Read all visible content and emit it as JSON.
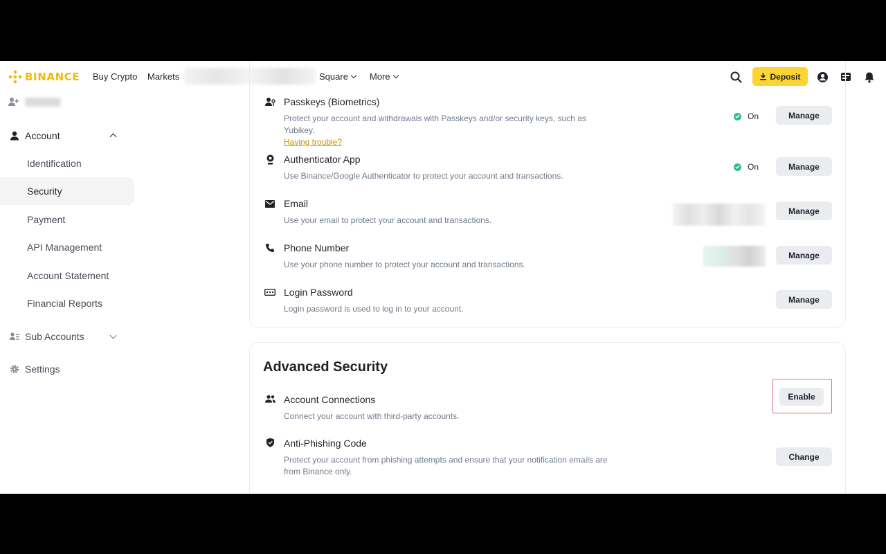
{
  "nav": {
    "logo": "BINANCE",
    "items": [
      "Buy Crypto",
      "Markets",
      "Square",
      "More"
    ],
    "deposit": "Deposit"
  },
  "sidebar": {
    "account": "Account",
    "items": [
      "Identification",
      "Security",
      "Payment",
      "API Management",
      "Account Statement",
      "Financial Reports"
    ],
    "active": "Security",
    "sub_accounts": "Sub Accounts",
    "settings": "Settings"
  },
  "security_rows": [
    {
      "title": "Passkeys (Biometrics)",
      "desc": "Protect your account and withdrawals with Passkeys and/or security keys, such as Yubikey.",
      "link": "Having trouble?",
      "status": "On",
      "button": "Manage",
      "icon": "passkey-icon"
    },
    {
      "title": "Authenticator App",
      "desc": "Use Binance/Google Authenticator to protect your account and transactions.",
      "status": "On",
      "button": "Manage",
      "icon": "authenticator-icon"
    },
    {
      "title": "Email",
      "desc": "Use your email to protect your account and transactions.",
      "button": "Manage",
      "icon": "mail-icon"
    },
    {
      "title": "Phone Number",
      "desc": "Use your phone number to protect your account and transactions.",
      "button": "Manage",
      "icon": "phone-icon"
    },
    {
      "title": "Login Password",
      "desc": "Login password is used to log in to your account.",
      "button": "Manage",
      "icon": "password-icon"
    }
  ],
  "advanced": {
    "title": "Advanced Security",
    "rows": [
      {
        "title": "Account Connections",
        "desc": "Connect your account with third-party accounts.",
        "button": "Enable",
        "icon": "people-icon"
      },
      {
        "title": "Anti-Phishing Code",
        "desc": "Protect your account from phishing attempts and ensure that your notification emails are from Binance only.",
        "button": "Change",
        "icon": "shield-icon"
      }
    ]
  },
  "colors": {
    "brand": "#F0B90B",
    "deposit": "#FCD535",
    "success": "#2EBD85",
    "highlight": "#E06C7C"
  }
}
